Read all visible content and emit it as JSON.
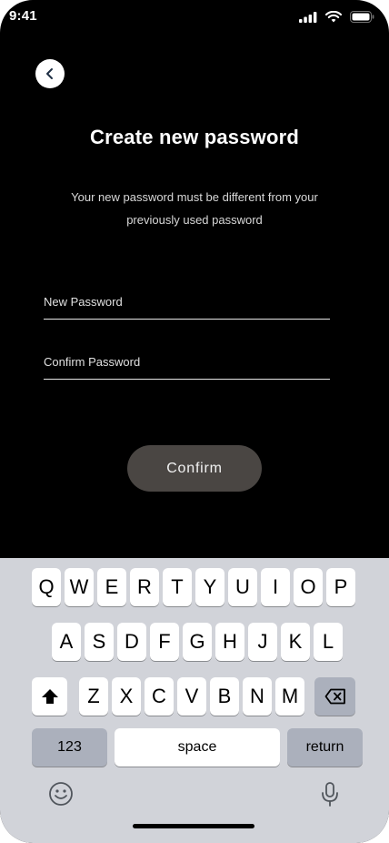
{
  "status_bar": {
    "time": "9:41"
  },
  "header": {
    "title": "Create new password"
  },
  "description": {
    "line1": "Your new password must be different from your",
    "line2": "previously used password"
  },
  "form": {
    "new_password_placeholder": "New Password",
    "confirm_password_placeholder": "Confirm Password",
    "confirm_label": "Confirm"
  },
  "keyboard": {
    "row1": [
      "Q",
      "W",
      "E",
      "R",
      "T",
      "Y",
      "U",
      "I",
      "O",
      "P"
    ],
    "row2": [
      "A",
      "S",
      "D",
      "F",
      "G",
      "H",
      "J",
      "K",
      "L"
    ],
    "row3": [
      "Z",
      "X",
      "C",
      "V",
      "B",
      "N",
      "M"
    ],
    "numbers_label": "123",
    "space_label": "space",
    "return_label": "return"
  },
  "icons": {
    "back": "chevron-left-icon",
    "shift": "shift-icon",
    "backspace": "backspace-icon",
    "emoji": "emoji-icon",
    "mic": "microphone-icon"
  }
}
